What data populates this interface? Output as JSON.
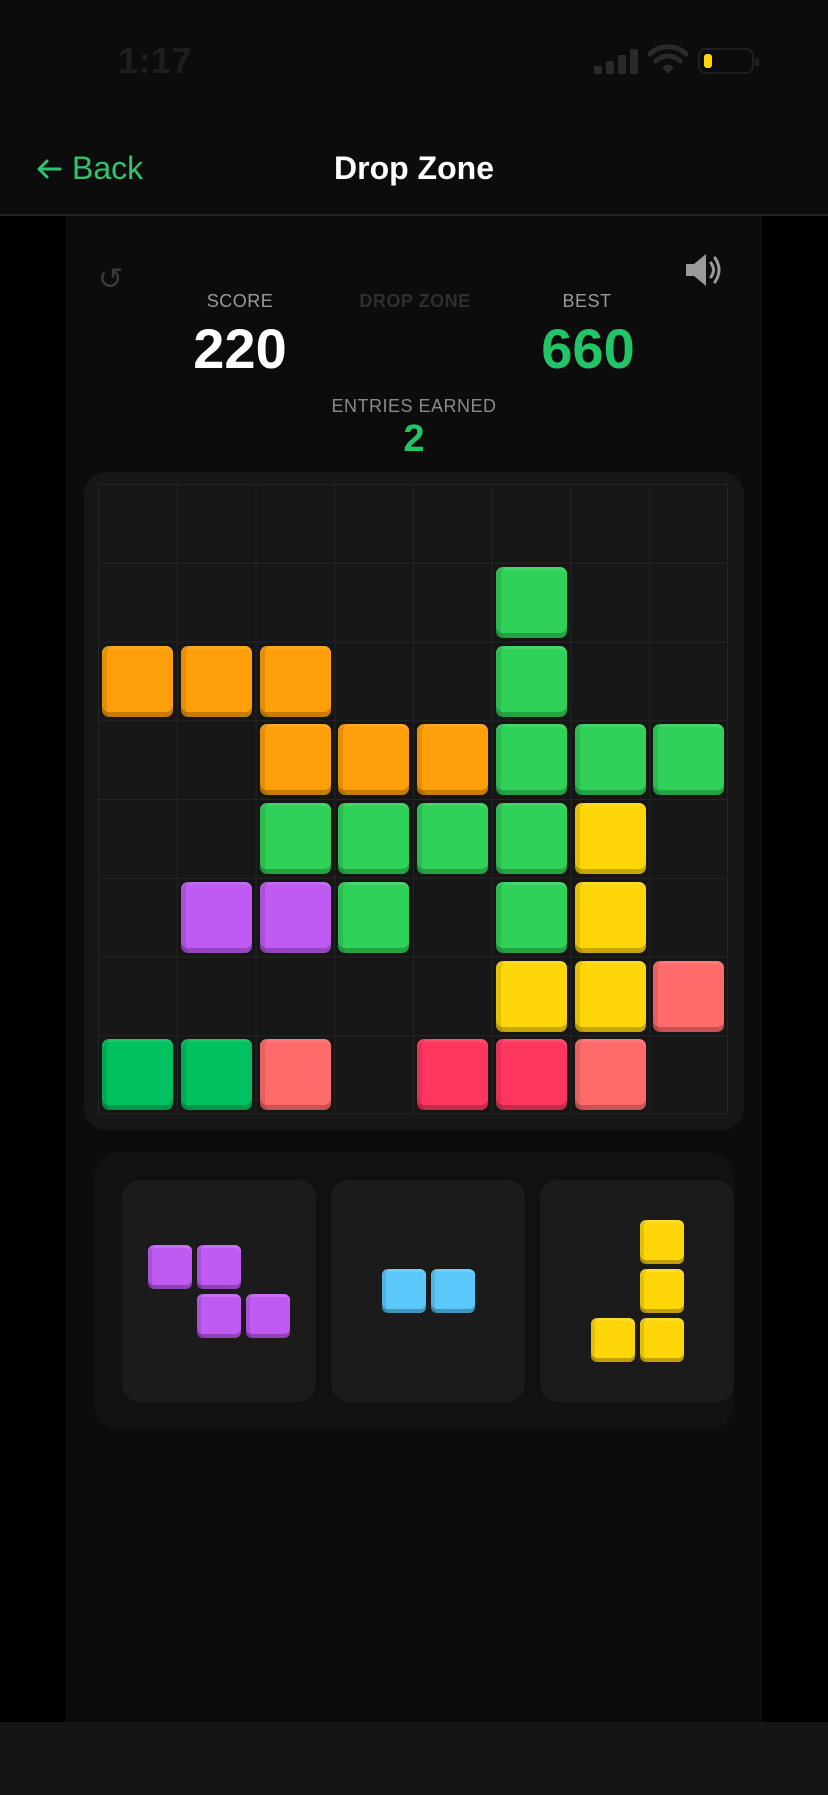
{
  "status_bar": {
    "time": "1:17"
  },
  "nav": {
    "back_label": "Back",
    "title": "Drop Zone"
  },
  "hud": {
    "score_label": "SCORE",
    "score_value": "220",
    "game_title": "DROP ZONE",
    "best_label": "BEST",
    "best_value": "660",
    "entries_label": "ENTRIES EARNED",
    "entries_value": "2"
  },
  "icons": {
    "restart": "restart-icon",
    "sound": "speaker-icon",
    "back": "arrow-left-icon"
  },
  "colors": {
    "orange": "#ff9f0a",
    "green": "#30d158",
    "dark_green": "#00c060",
    "yellow": "#ffd60a",
    "purple": "#bf5af2",
    "salmon": "#ff6b6b",
    "red": "#ff375f",
    "blue": "#5ac8fa",
    "accent": "#2ec46f"
  },
  "board": {
    "rows": 8,
    "cols": 8,
    "cells": [
      {
        "row": 1,
        "col": 5,
        "color": "green"
      },
      {
        "row": 2,
        "col": 0,
        "color": "orange"
      },
      {
        "row": 2,
        "col": 1,
        "color": "orange"
      },
      {
        "row": 2,
        "col": 2,
        "color": "orange"
      },
      {
        "row": 2,
        "col": 5,
        "color": "green"
      },
      {
        "row": 3,
        "col": 2,
        "color": "orange"
      },
      {
        "row": 3,
        "col": 3,
        "color": "orange"
      },
      {
        "row": 3,
        "col": 4,
        "color": "orange"
      },
      {
        "row": 3,
        "col": 5,
        "color": "green"
      },
      {
        "row": 3,
        "col": 6,
        "color": "green"
      },
      {
        "row": 3,
        "col": 7,
        "color": "green"
      },
      {
        "row": 4,
        "col": 2,
        "color": "green"
      },
      {
        "row": 4,
        "col": 3,
        "color": "green"
      },
      {
        "row": 4,
        "col": 4,
        "color": "green"
      },
      {
        "row": 4,
        "col": 5,
        "color": "green"
      },
      {
        "row": 4,
        "col": 6,
        "color": "yellow"
      },
      {
        "row": 5,
        "col": 1,
        "color": "purple"
      },
      {
        "row": 5,
        "col": 2,
        "color": "purple"
      },
      {
        "row": 5,
        "col": 3,
        "color": "green"
      },
      {
        "row": 5,
        "col": 5,
        "color": "green"
      },
      {
        "row": 5,
        "col": 6,
        "color": "yellow"
      },
      {
        "row": 6,
        "col": 5,
        "color": "yellow"
      },
      {
        "row": 6,
        "col": 6,
        "color": "yellow"
      },
      {
        "row": 6,
        "col": 7,
        "color": "salmon"
      },
      {
        "row": 7,
        "col": 0,
        "color": "dark_green"
      },
      {
        "row": 7,
        "col": 1,
        "color": "dark_green"
      },
      {
        "row": 7,
        "col": 2,
        "color": "salmon"
      },
      {
        "row": 7,
        "col": 4,
        "color": "red"
      },
      {
        "row": 7,
        "col": 5,
        "color": "red"
      },
      {
        "row": 7,
        "col": 6,
        "color": "salmon"
      }
    ]
  },
  "pieces": [
    {
      "color": "purple",
      "cells": [
        [
          0,
          0
        ],
        [
          0,
          1
        ],
        [
          1,
          1
        ],
        [
          1,
          2
        ]
      ]
    },
    {
      "color": "blue",
      "cells": [
        [
          0,
          0
        ],
        [
          0,
          1
        ]
      ]
    },
    {
      "color": "yellow",
      "cells": [
        [
          0,
          1
        ],
        [
          1,
          1
        ],
        [
          2,
          0
        ],
        [
          2,
          1
        ]
      ]
    }
  ]
}
